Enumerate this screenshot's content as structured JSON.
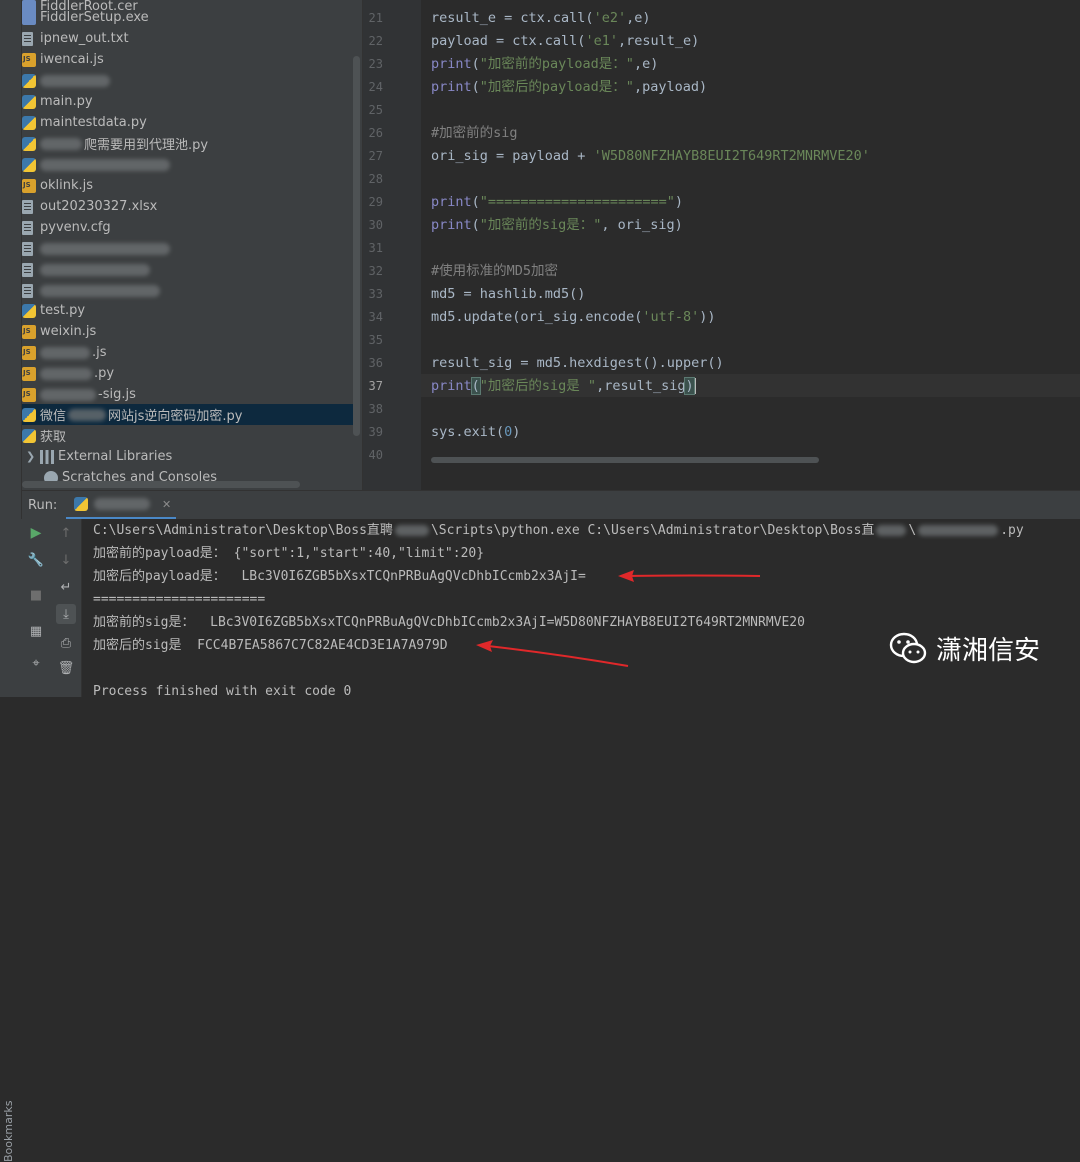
{
  "project_tree": {
    "items": [
      {
        "label": "FiddlerSetup.exe",
        "icon": "exe-file-icon"
      },
      {
        "label": "ipnew_out.txt",
        "icon": "text-file-icon"
      },
      {
        "label": "iwencai.js",
        "icon": "js-file-icon"
      },
      {
        "label": "",
        "icon": "python-file-icon",
        "redacted": true
      },
      {
        "label": "main.py",
        "icon": "python-file-icon"
      },
      {
        "label": "maintestdata.py",
        "icon": "python-file-icon"
      },
      {
        "label": "爬需要用到代理池.py",
        "icon": "python-file-icon"
      },
      {
        "label": "",
        "icon": "python-file-icon",
        "redacted": true
      },
      {
        "label": "oklink.js",
        "icon": "js-file-icon"
      },
      {
        "label": "out20230327.xlsx",
        "icon": "text-file-icon"
      },
      {
        "label": "pyvenv.cfg",
        "icon": "text-file-icon"
      },
      {
        "label": "",
        "icon": "text-file-icon",
        "redacted": true
      },
      {
        "label": "",
        "icon": "text-file-icon",
        "redacted": true
      },
      {
        "label": "",
        "icon": "text-file-icon",
        "redacted": true
      },
      {
        "label": "test.py",
        "icon": "python-file-icon"
      },
      {
        "label": "weixin.js",
        "icon": "js-file-icon"
      },
      {
        "label": ".js",
        "icon": "js-file-icon",
        "partial": true
      },
      {
        "label": ".py",
        "icon": "js-file-icon",
        "partial": true
      },
      {
        "label": "-sig.js",
        "icon": "js-file-icon",
        "partial": true
      },
      {
        "label": "网站js逆向密码加密.py",
        "prefix": "微信",
        "icon": "python-file-icon",
        "partial": true,
        "selected": true
      },
      {
        "label": "获取",
        "icon": "python-file-icon"
      }
    ],
    "external_libraries": "External Libraries",
    "scratches": "Scratches and Consoles"
  },
  "editor": {
    "current_line": "37",
    "lines": [
      {
        "n": "21",
        "text": "result_e = ctx.call('e2',e)"
      },
      {
        "n": "22",
        "text": "payload = ctx.call('e1',result_e)"
      },
      {
        "n": "23",
        "text": "print(\"加密前的payload是：\",e)"
      },
      {
        "n": "24",
        "text": "print(\"加密后的payload是：\",payload)"
      },
      {
        "n": "25",
        "text": ""
      },
      {
        "n": "26",
        "text": "#加密前的sig"
      },
      {
        "n": "27",
        "text": "ori_sig = payload + 'W5D80NFZHAYB8EUI2T649RT2MNRMVE20'"
      },
      {
        "n": "28",
        "text": ""
      },
      {
        "n": "29",
        "text": "print(\"======================\")"
      },
      {
        "n": "30",
        "text": "print(\"加密前的sig是：\", ori_sig)"
      },
      {
        "n": "31",
        "text": ""
      },
      {
        "n": "32",
        "text": "#使用标准的MD5加密"
      },
      {
        "n": "33",
        "text": "md5 = hashlib.md5()"
      },
      {
        "n": "34",
        "text": "md5.update(ori_sig.encode('utf-8'))"
      },
      {
        "n": "35",
        "text": ""
      },
      {
        "n": "36",
        "text": "result_sig = md5.hexdigest().upper()"
      },
      {
        "n": "37",
        "text": "print(\"加密后的sig是 \",result_sig)"
      },
      {
        "n": "38",
        "text": ""
      },
      {
        "n": "39",
        "text": "sys.exit(0)"
      },
      {
        "n": "40",
        "text": ""
      }
    ]
  },
  "run_panel": {
    "label": "Run:",
    "tab_name": "",
    "bookmarks": "Bookmarks",
    "console": {
      "cmd_a": "C:\\Users\\Administrator\\Desktop\\Boss直聘",
      "cmd_b": "\\Scripts\\python.exe C:\\Users\\Administrator\\Desktop\\Boss直",
      "cmd_c": "\\",
      "cmd_d": ".py",
      "line2": "加密前的payload是： {\"sort\":1,\"start\":40,\"limit\":20}",
      "line3": "加密后的payload是：  LBc3V0I6ZGB5bXsxTCQnPRBuAgQVcDhbICcmb2x3AjI=",
      "line4": "======================",
      "line5": "加密前的sig是：  LBc3V0I6ZGB5bXsxTCQnPRBuAgQVcDhbICcmb2x3AjI=W5D80NFZHAYB8EUI2T649RT2MNRMVE20",
      "line6": "加密后的sig是  FCC4B7EA5867C7C82AE4CD3E1A7A979D",
      "line7": "Process finished with exit code 0"
    }
  },
  "watermark": {
    "text": "潇湘信安",
    "icon": "wechat-icon"
  },
  "colors": {
    "accent": "#4a88c7",
    "arrow": "#e0282a",
    "string": "#6a8759",
    "keyword": "#8888c6"
  }
}
